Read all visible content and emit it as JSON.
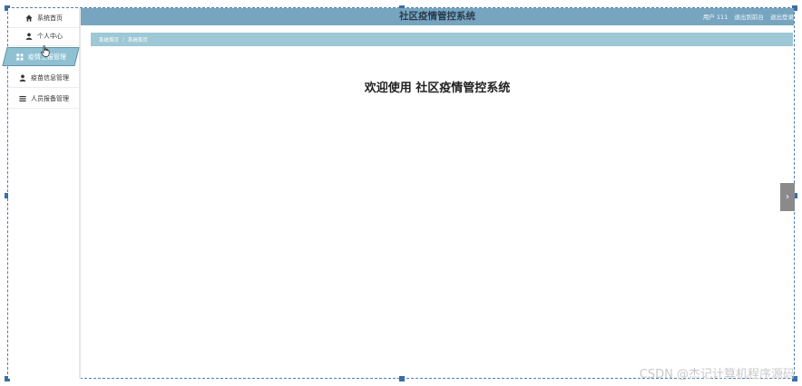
{
  "header": {
    "title": "社区疫情管控系统",
    "user_label": "用户 111",
    "back_link": "退出到前台",
    "logout_link": "退出登录"
  },
  "sidebar": {
    "items": [
      {
        "label": "系统首页",
        "icon": "home-icon"
      },
      {
        "label": "个人中心",
        "icon": "user-icon"
      },
      {
        "label": "疫情上报管理",
        "icon": "grid-icon",
        "active": true
      },
      {
        "label": "疫苗信息管理",
        "icon": "user-icon"
      },
      {
        "label": "人员报备管理",
        "icon": "list-icon"
      }
    ]
  },
  "breadcrumb": {
    "items": [
      "系统首页",
      "系统首页"
    ],
    "separator": "/"
  },
  "main": {
    "welcome": "欢迎使用 社区疫情管控系统"
  },
  "side_toggle": {
    "icon": "chevron-right-icon",
    "label": "›"
  },
  "watermark": "CSDN @杰记计算机程序源码",
  "colors": {
    "header": "#77a5c0",
    "breadcrumb": "#9ec8d5",
    "active_nav": "#8fc1d3",
    "title_text": "#2b3d4e"
  }
}
